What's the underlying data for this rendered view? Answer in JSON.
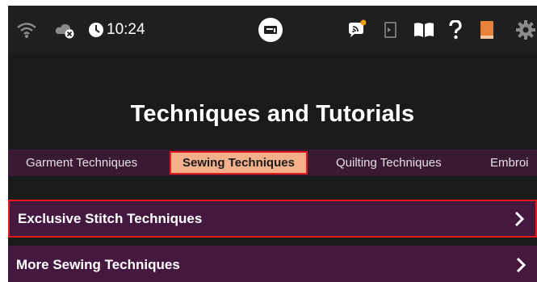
{
  "status_bar": {
    "time": "10:24",
    "icons": [
      "wifi-icon",
      "cloud-off-icon",
      "clock-icon",
      "machine-icon",
      "message-icon",
      "exit-icon",
      "book-icon",
      "help-icon",
      "library-icon",
      "settings-icon"
    ],
    "notification_color": "#f39c12"
  },
  "page": {
    "title": "Techniques and Tutorials"
  },
  "tabs": [
    {
      "label": "Garment Techniques",
      "selected": false
    },
    {
      "label": "Sewing Techniques",
      "selected": true
    },
    {
      "label": "Quilting Techniques",
      "selected": false
    },
    {
      "label": "Embroi",
      "selected": false
    }
  ],
  "list": {
    "items": [
      {
        "label": "Exclusive Stitch Techniques",
        "highlighted": true
      },
      {
        "label": "More Sewing Techniques",
        "highlighted": false
      }
    ]
  },
  "colors": {
    "background": "#1a1a1a",
    "tab_bar": "#3a1a32",
    "selected_tab": "#f3b08a",
    "list_item": "#45193f",
    "highlight_border": "#e11b1b",
    "library_icon": "#e8823a"
  }
}
